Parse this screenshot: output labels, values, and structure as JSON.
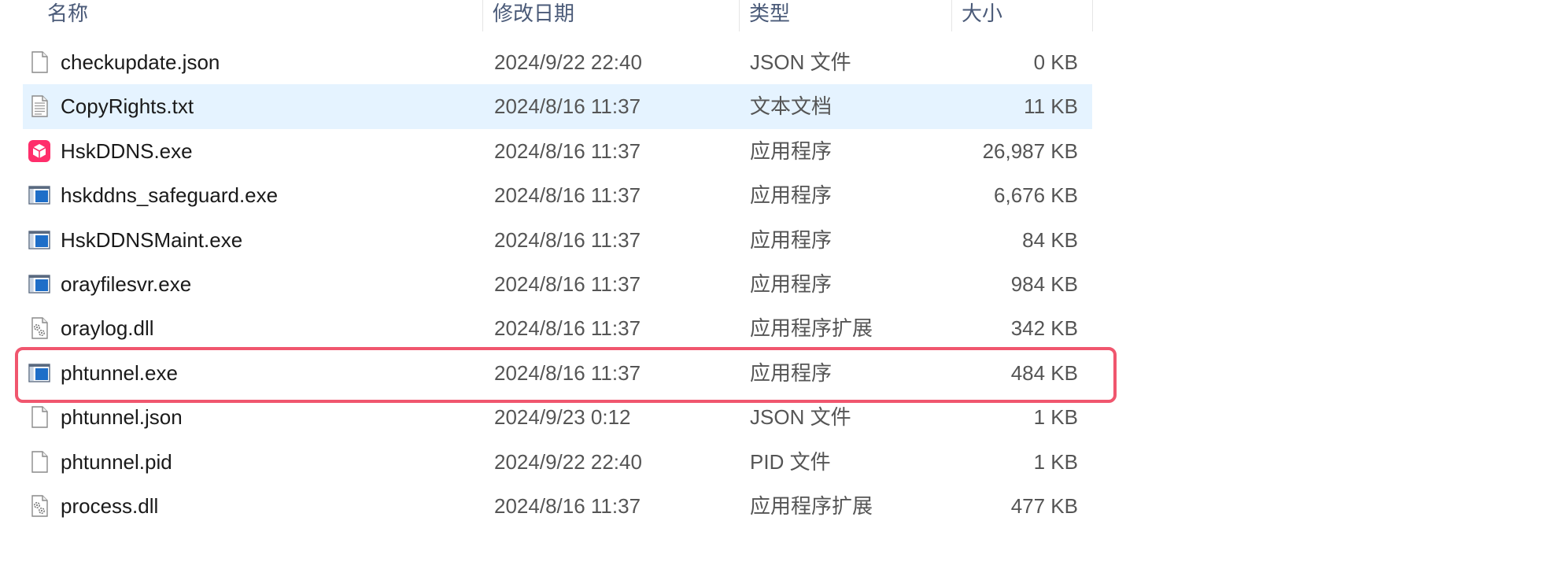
{
  "columns": {
    "name": "名称",
    "date": "修改日期",
    "type": "类型",
    "size": "大小"
  },
  "files": [
    {
      "name": "checkupdate.json",
      "date": "2024/9/22 22:40",
      "type": "JSON 文件",
      "size": "0 KB",
      "icon": "blank-file-icon",
      "selected": false
    },
    {
      "name": "CopyRights.txt",
      "date": "2024/8/16 11:37",
      "type": "文本文档",
      "size": "11 KB",
      "icon": "text-file-icon",
      "selected": true
    },
    {
      "name": "HskDDNS.exe",
      "date": "2024/8/16 11:37",
      "type": "应用程序",
      "size": "26,987 KB",
      "icon": "hskddns-app-icon",
      "selected": false
    },
    {
      "name": "hskddns_safeguard.exe",
      "date": "2024/8/16 11:37",
      "type": "应用程序",
      "size": "6,676 KB",
      "icon": "exe-window-icon",
      "selected": false
    },
    {
      "name": "HskDDNSMaint.exe",
      "date": "2024/8/16 11:37",
      "type": "应用程序",
      "size": "84 KB",
      "icon": "exe-window-icon",
      "selected": false
    },
    {
      "name": "orayfilesvr.exe",
      "date": "2024/8/16 11:37",
      "type": "应用程序",
      "size": "984 KB",
      "icon": "exe-window-icon",
      "selected": false
    },
    {
      "name": "oraylog.dll",
      "date": "2024/8/16 11:37",
      "type": "应用程序扩展",
      "size": "342 KB",
      "icon": "dll-gear-icon",
      "selected": false
    },
    {
      "name": "phtunnel.exe",
      "date": "2024/8/16 11:37",
      "type": "应用程序",
      "size": "484 KB",
      "icon": "exe-window-icon",
      "selected": false
    },
    {
      "name": "phtunnel.json",
      "date": "2024/9/23 0:12",
      "type": "JSON 文件",
      "size": "1 KB",
      "icon": "blank-file-icon",
      "selected": false
    },
    {
      "name": "phtunnel.pid",
      "date": "2024/9/22 22:40",
      "type": "PID 文件",
      "size": "1 KB",
      "icon": "blank-file-icon",
      "selected": false
    },
    {
      "name": "process.dll",
      "date": "2024/8/16 11:37",
      "type": "应用程序扩展",
      "size": "477 KB",
      "icon": "dll-gear-icon",
      "selected": false
    }
  ],
  "colors": {
    "selection": "#e5f3ff",
    "highlight_border": "#f0566e",
    "hskddns_brand": "#ff2e6b",
    "exe_blue": "#1e6ec8"
  }
}
